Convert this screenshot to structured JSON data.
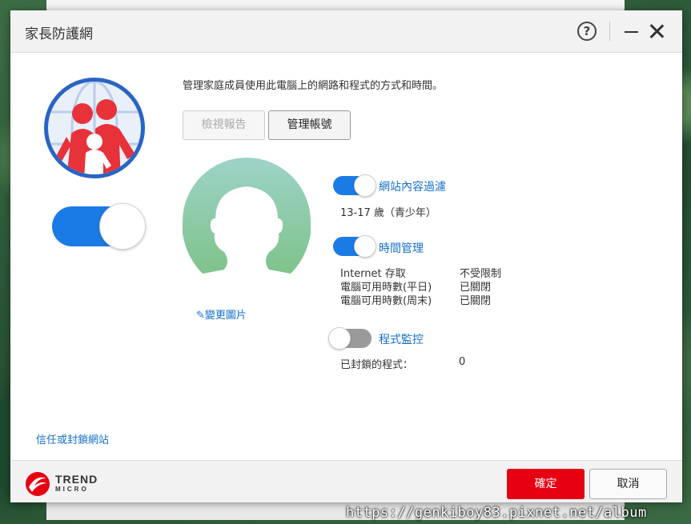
{
  "window": {
    "title": "家長防護網",
    "help_label": "?"
  },
  "intro": {
    "description": "管理家庭成員使用此電腦上的網路和程式的方式和時間。"
  },
  "buttons": {
    "view_report": "檢視報告",
    "manage_account": "管理帳號",
    "ok": "確定",
    "cancel": "取消"
  },
  "profile": {
    "change_picture": "變更圖片",
    "pencil": "✎"
  },
  "features": {
    "web_filter": {
      "label": "網站內容過濾",
      "enabled": true,
      "age_group": "13-17 歲（青少年）"
    },
    "time_management": {
      "label": "時間管理",
      "enabled": true,
      "rows": [
        {
          "label": "Internet 存取",
          "value": "不受限制"
        },
        {
          "label": "電腦可用時數(平日)",
          "value": "已關閉"
        },
        {
          "label": "電腦可用時數(周末)",
          "value": "已關閉"
        }
      ]
    },
    "program_control": {
      "label": "程式監控",
      "enabled": false,
      "blocked_label": "已封鎖的程式：",
      "blocked_count": "0"
    }
  },
  "master_toggle": {
    "enabled": true
  },
  "links": {
    "trust_block": "信任或封鎖網站"
  },
  "brand": {
    "top": "TREND",
    "bottom": "MICRO"
  },
  "watermark": "https://genkiboy83.pixnet.net/album",
  "colors": {
    "accent": "#1a7be6",
    "link": "#1670c8",
    "primary_button": "#e60012"
  }
}
